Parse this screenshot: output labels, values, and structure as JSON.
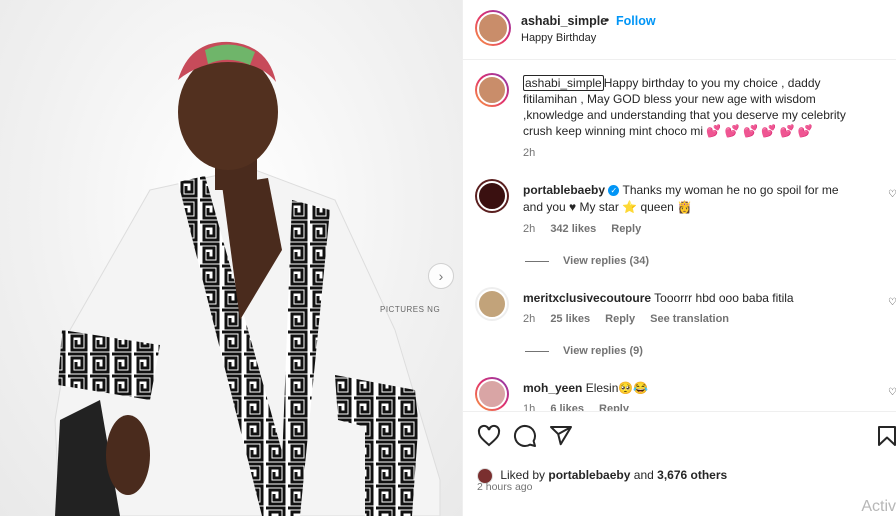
{
  "post": {
    "username": "ashabi_simple",
    "follow_label": "Follow",
    "subtitle": "Happy Birthday",
    "photo_watermark": "PICTURES NG",
    "caption": {
      "username": "ashabi_simple",
      "text": "Happy birthday to you my choice , daddy fitilamihan , May GOD bless your new age with wisdom ,knowledge and understanding that you deserve my celebrity crush keep winning mint choco mi 💕 💕 💕 💕 💕 💕",
      "time": "2h"
    },
    "comments": [
      {
        "username": "portablebaeby",
        "verified": true,
        "text": "Thanks my woman he no go spoil for me and you ♥ My star ⭐ queen 👸",
        "time": "2h",
        "likes": "342 likes",
        "reply_label": "Reply",
        "view_replies": "View replies (34)"
      },
      {
        "username": "meritxclusivecoutoure",
        "text": "Tooorrr hbd ooo baba fitila",
        "time": "2h",
        "likes": "25 likes",
        "reply_label": "Reply",
        "see_translation": "See translation",
        "view_replies": "View replies (9)"
      },
      {
        "username": "moh_yeen",
        "text": "Elesin🥺😂",
        "time": "1h",
        "likes": "6 likes",
        "reply_label": "Reply"
      }
    ],
    "liked_by_prefix": "Liked by",
    "liked_by_user": "portablebaeby",
    "liked_by_and": "and",
    "liked_by_others": "3,676 others",
    "posted_ago": "2 hours ago"
  },
  "overlay": {
    "activate_text": "Activ"
  },
  "icons": {
    "like": "heart-icon",
    "comment": "comment-icon",
    "share": "share-icon",
    "save": "bookmark-icon",
    "next": "chevron-right-icon"
  },
  "colors": {
    "link_blue": "#0095f6",
    "text": "#262626",
    "muted": "#737373"
  }
}
